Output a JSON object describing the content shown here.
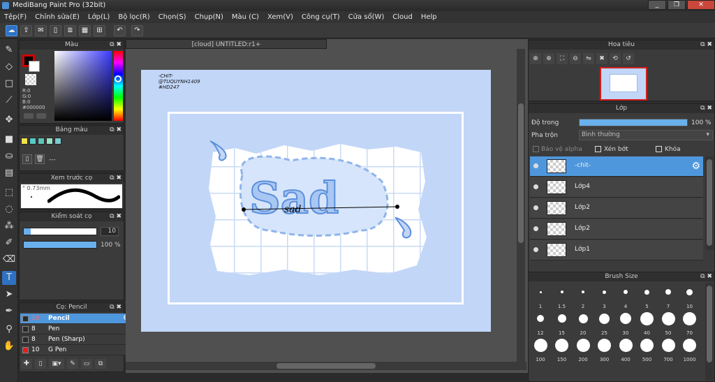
{
  "window": {
    "title": "MediBang Paint Pro (32bit)",
    "btn_min": "_",
    "btn_max": "❐",
    "btn_close": "✕"
  },
  "menu": [
    "Tệp(F)",
    "Chỉnh sửa(E)",
    "Lớp(L)",
    "Bộ lọc(R)",
    "Chọn(S)",
    "Chụp(N)",
    "Màu (C)",
    "Xem(V)",
    "Công cụ(T)",
    "Cửa sổ(W)",
    "Cloud",
    "Help"
  ],
  "toolbar_icons": [
    "cloud-icon",
    "share-icon",
    "comment-icon",
    "page-icon",
    "document-icon",
    "grid-page-icon",
    "multi-page-icon",
    "undo-icon",
    "redo-icon"
  ],
  "panels": {
    "color": {
      "title": "Màu",
      "r": "R:0",
      "g": "G:0",
      "b": "B:0",
      "hex": "#000000",
      "fg": "#000000",
      "bg": "#ffffff"
    },
    "palette": {
      "title": "Bảng màu",
      "colors": [
        "#f2e14a",
        "#58c9c4",
        "#5fc4b8",
        "#98e0c8",
        "#7ecbd1"
      ],
      "dash": "---"
    },
    "brush_preview": {
      "title": "Xem trước cọ",
      "size": "0.73mm"
    },
    "brush_control": {
      "title": "Kiểm soát cọ",
      "size": "10",
      "opacity": "100 %",
      "size_frac": 0.1,
      "opacity_frac": 1
    },
    "brush_list": {
      "title": "Cọ: Pencil",
      "items": [
        {
          "size": "10",
          "name": "Pencil",
          "color": "#2a2a2a"
        },
        {
          "size": "8",
          "name": "Pen",
          "color": "#2a2a2a"
        },
        {
          "size": "8",
          "name": "Pen (Sharp)",
          "color": "#2a2a2a"
        },
        {
          "size": "10",
          "name": "G Pen",
          "color": "#e02020"
        }
      ]
    }
  },
  "canvas": {
    "tab": "[cloud] UNTITLED:r1+",
    "credit": [
      "-CHIT-",
      "@TUQUYNH1409",
      "#HD247"
    ],
    "art_text": "Sad",
    "script_text": "sad"
  },
  "navigator": {
    "title": "Hoa tiêu"
  },
  "layers": {
    "title": "Lớp",
    "opacity_label": "Độ trong",
    "opacity_value": "100 %",
    "opacity_frac": 1,
    "blend_label": "Pha trộn",
    "blend_value": "Bình thường",
    "protect_alpha": "Bảo vệ alpha",
    "clipping": "Xén bớt",
    "lock": "Khóa",
    "items": [
      {
        "name": "-chit-"
      },
      {
        "name": "Lớp4"
      },
      {
        "name": "Lớp2"
      },
      {
        "name": "Lớp2"
      },
      {
        "name": "Lớp1"
      }
    ]
  },
  "brush_size": {
    "title": "Brush Size",
    "sizes": [
      "1",
      "1.5",
      "2",
      "3",
      "4",
      "5",
      "7",
      "10",
      "12",
      "15",
      "20",
      "25",
      "30",
      "40",
      "50",
      "70",
      "100",
      "150",
      "200",
      "300",
      "400",
      "500",
      "700",
      "1000"
    ]
  }
}
